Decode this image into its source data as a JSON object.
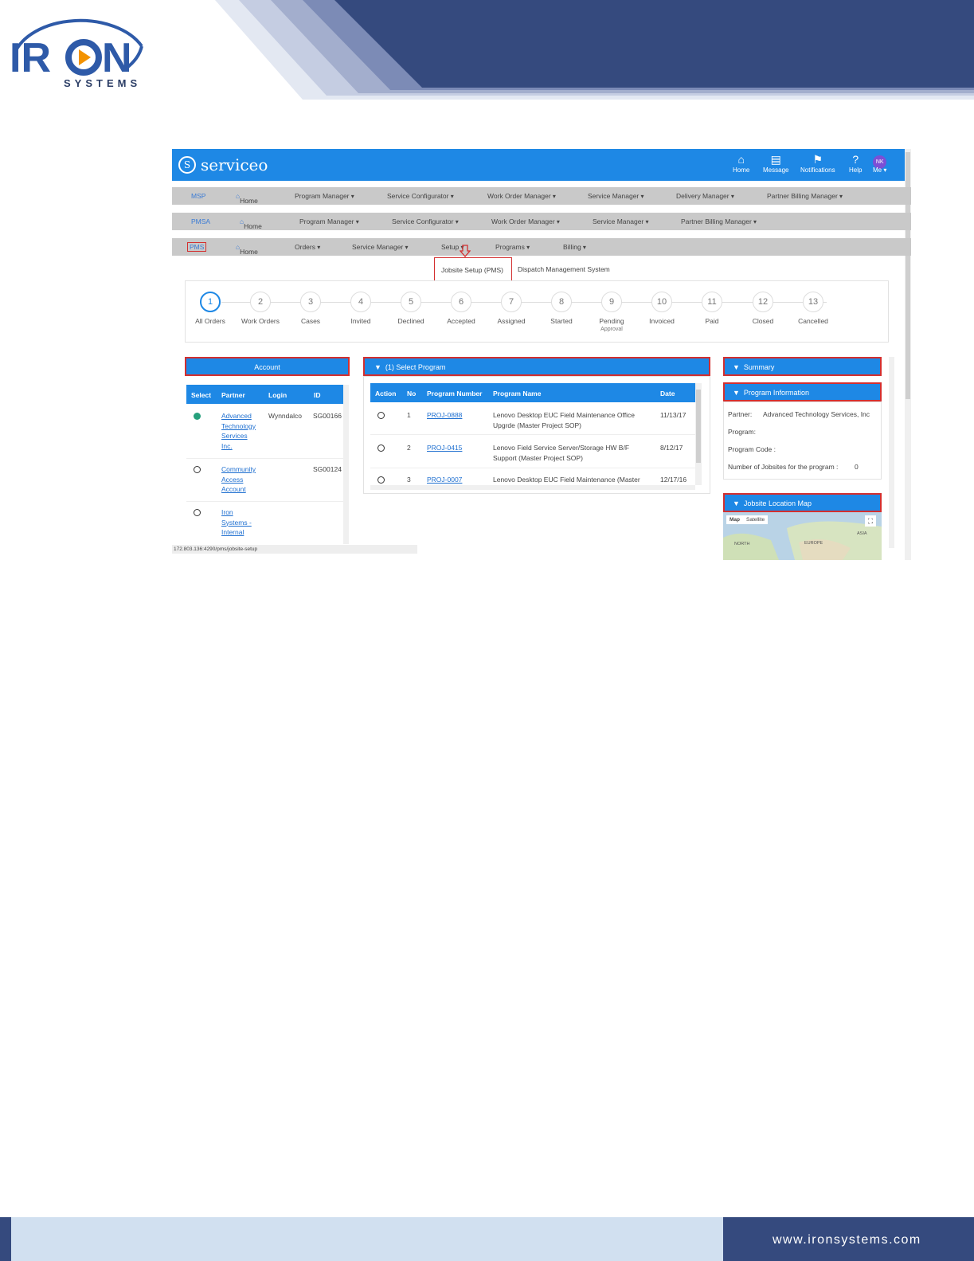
{
  "logo": {
    "name": "IRON",
    "tagline": "SYSTEMS"
  },
  "footer": {
    "url": "www.ironsystems.com"
  },
  "app": {
    "brand": "serviceo",
    "top_icons": [
      {
        "label": "Home",
        "icon": "home-icon"
      },
      {
        "label": "Message",
        "icon": "message-icon"
      },
      {
        "label": "Notifications",
        "icon": "bell-icon"
      },
      {
        "label": "Help",
        "icon": "help-icon"
      },
      {
        "label": "Me",
        "avatar": "NK"
      }
    ]
  },
  "nav_msp": {
    "first": "MSP",
    "home": "Home",
    "items": [
      "Program Manager",
      "Service Configurator",
      "Work Order Manager",
      "Service Manager",
      "Delivery Manager",
      "Partner Billing Manager"
    ]
  },
  "nav_pmsa": {
    "first": "PMSA",
    "home": "Home",
    "items": [
      "Program Manager",
      "Service Configurator",
      "Work Order Manager",
      "Service Manager",
      "Partner Billing Manager"
    ]
  },
  "nav_pms": {
    "first": "PMS",
    "home": "Home",
    "items": [
      "Orders",
      "Service Manager",
      "Setup",
      "Programs",
      "Billing"
    ]
  },
  "setup_menu": {
    "item1": "Jobsite Setup (PMS)",
    "item2": "Dispatch Management System"
  },
  "steps": [
    {
      "num": "1",
      "label": "All Orders"
    },
    {
      "num": "2",
      "label": "Work Orders"
    },
    {
      "num": "3",
      "label": "Cases"
    },
    {
      "num": "4",
      "label": "Invited"
    },
    {
      "num": "5",
      "label": "Declined"
    },
    {
      "num": "6",
      "label": "Accepted"
    },
    {
      "num": "7",
      "label": "Assigned"
    },
    {
      "num": "8",
      "label": "Started"
    },
    {
      "num": "9",
      "label": "Pending",
      "sub": "Approval"
    },
    {
      "num": "10",
      "label": "Invoiced"
    },
    {
      "num": "11",
      "label": "Paid"
    },
    {
      "num": "12",
      "label": "Closed"
    },
    {
      "num": "13",
      "label": "Cancelled"
    }
  ],
  "account_panel": {
    "title": "Account",
    "headers": [
      "Select",
      "Partner",
      "Login",
      "ID"
    ],
    "rows": [
      {
        "partner": [
          "Advanced",
          "Technology",
          "Services",
          "Inc."
        ],
        "login": "Wynndalco",
        "id": "SG00166",
        "selected": true
      },
      {
        "partner": [
          "Community",
          "Access",
          "Account"
        ],
        "login": "",
        "id": "SG00124",
        "selected": false
      },
      {
        "partner": [
          "Iron",
          "Systems -",
          "Internal"
        ],
        "login": "",
        "id": "",
        "selected": false
      }
    ]
  },
  "program_panel": {
    "title": "(1) Select Program",
    "headers": [
      "Action",
      "No",
      "Program Number",
      "Program Name",
      "Date"
    ],
    "rows": [
      {
        "no": "1",
        "number": "PROJ-0888",
        "name": [
          "Lenovo Desktop EUC Field Maintenance Office",
          "Upgrde (Master Project SOP)"
        ],
        "date": "11/13/17"
      },
      {
        "no": "2",
        "number": "PROJ-0415",
        "name": [
          "Lenovo Field Service Server/Storage HW B/F",
          "Support (Master Project SOP)"
        ],
        "date": "8/12/17"
      },
      {
        "no": "3",
        "number": "PROJ-0007",
        "name": [
          "Lenovo Desktop EUC Field Maintenance (Master"
        ],
        "date": "12/17/16"
      }
    ]
  },
  "summary_panel": {
    "title": "Summary"
  },
  "program_info": {
    "title": "Program Information",
    "partner_label": "Partner:",
    "partner_value": "Advanced Technology Services, Inc",
    "program_label": "Program:",
    "code_label": "Program Code :",
    "jobsites_label": "Number of Jobsites for the program :",
    "jobsites_value": "0"
  },
  "map_panel": {
    "title": "Jobsite Location Map",
    "map_btn": "Map",
    "satellite_btn": "Satellite",
    "label_asia": "ASIA",
    "label_europe": "EUROPE",
    "label_north": "NORTH"
  },
  "status_url": "172.803.136:4290/pms/jobsite-setup",
  "colors": {
    "accent": "#1e88e5",
    "banner": "#354a7e",
    "highlight": "#d32f2f"
  }
}
